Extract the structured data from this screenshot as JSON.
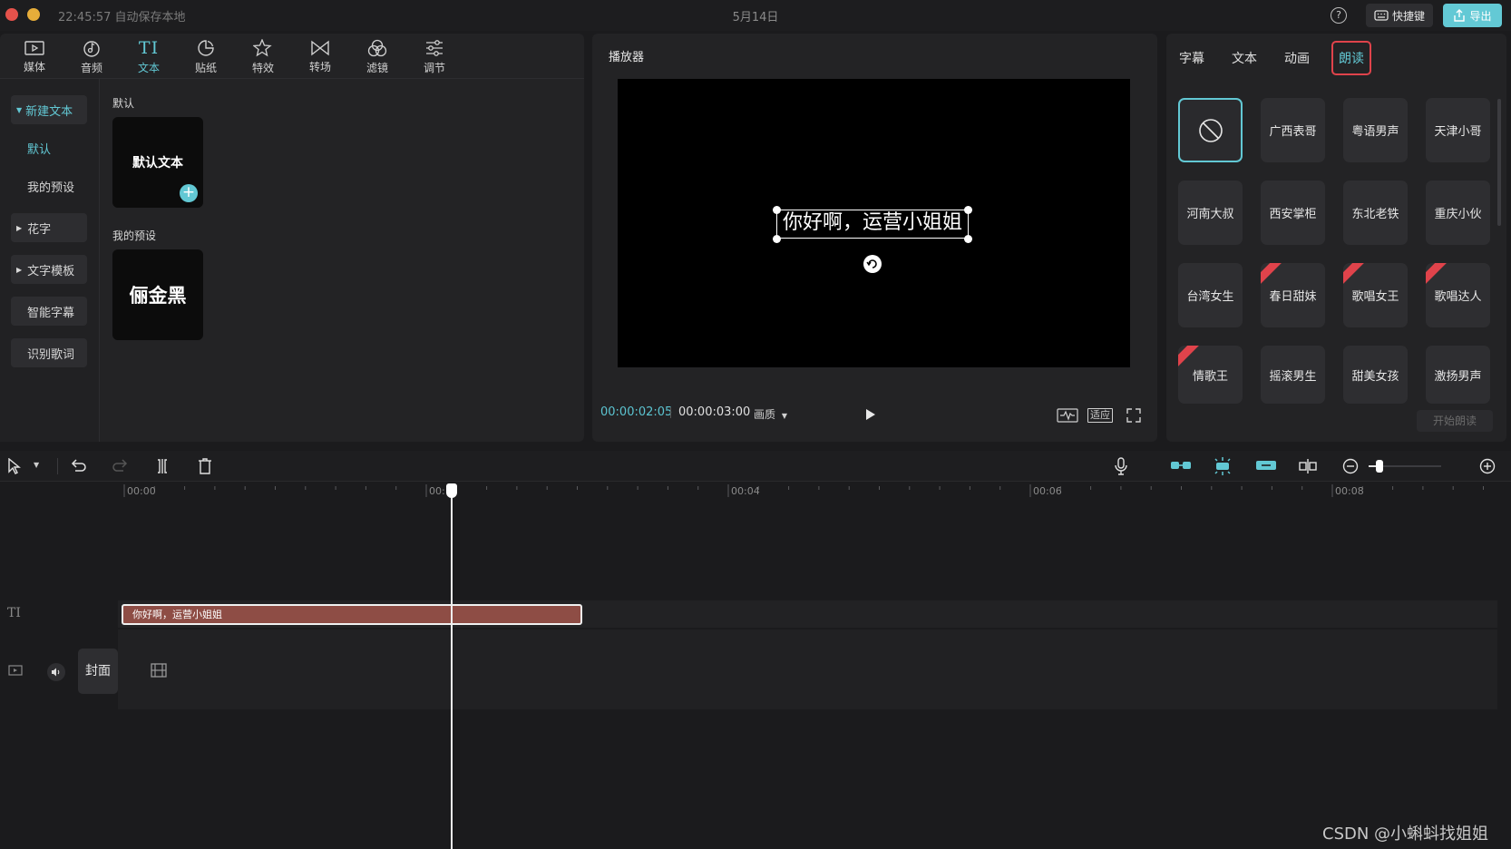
{
  "titlebar": {
    "status": "22:45:57 自动保存本地",
    "title": "5月14日",
    "help_label": "?",
    "shortcut_label": "快捷键",
    "export_label": "导出"
  },
  "toolbar": {
    "items": [
      {
        "label": "媒体",
        "icon": "media-icon"
      },
      {
        "label": "音频",
        "icon": "audio-icon"
      },
      {
        "label": "文本",
        "icon": "text-icon"
      },
      {
        "label": "贴纸",
        "icon": "sticker-icon"
      },
      {
        "label": "特效",
        "icon": "effects-icon"
      },
      {
        "label": "转场",
        "icon": "transition-icon"
      },
      {
        "label": "滤镜",
        "icon": "filter-icon"
      },
      {
        "label": "调节",
        "icon": "adjust-icon"
      }
    ],
    "text_icon_glyph": "TI"
  },
  "sidebar": {
    "new_text": "新建文本",
    "default": "默认",
    "my_presets": "我的预设",
    "fancy": "花字",
    "templates": "文字模板",
    "smart_subtitles": "智能字幕",
    "lyrics": "识别歌词"
  },
  "content": {
    "default_heading": "默认",
    "default_card": "默认文本",
    "presets_heading": "我的预设",
    "preset_card": "俪金黑"
  },
  "player": {
    "title": "播放器",
    "caption": "你好啊，运营小姐姐",
    "time_current": "00:00:02:05",
    "time_total": "00:00:03:00",
    "quality": "画质",
    "fit_label": "适应"
  },
  "right_panel": {
    "tabs": [
      "字幕",
      "文本",
      "动画",
      "朗读"
    ],
    "active_tab": "朗读",
    "voices": [
      "广西表哥",
      "粤语男声",
      "天津小哥",
      "河南大叔",
      "西安掌柜",
      "东北老铁",
      "重庆小伙",
      "台湾女生",
      "春日甜妹",
      "歌唱女王",
      "歌唱达人",
      "情歌王",
      "摇滚男生",
      "甜美女孩",
      "激扬男声"
    ],
    "start_button": "开始朗读"
  },
  "timeline": {
    "ticks": [
      "00:00",
      "00:",
      "00:04",
      "00:06",
      "00:08"
    ],
    "clip_label": "你好啊，运营小姐姐",
    "text_track_glyph": "TI",
    "cover_label": "封面",
    "playhead_time": "00:00:02:05"
  },
  "watermark": "CSDN @小蝌蚪找姐姐",
  "colors": {
    "accent": "#62c8d4",
    "highlight_border": "#e0434b",
    "clip": "#8e4d45",
    "background": "#1b1b1d",
    "panel": "#232325"
  }
}
